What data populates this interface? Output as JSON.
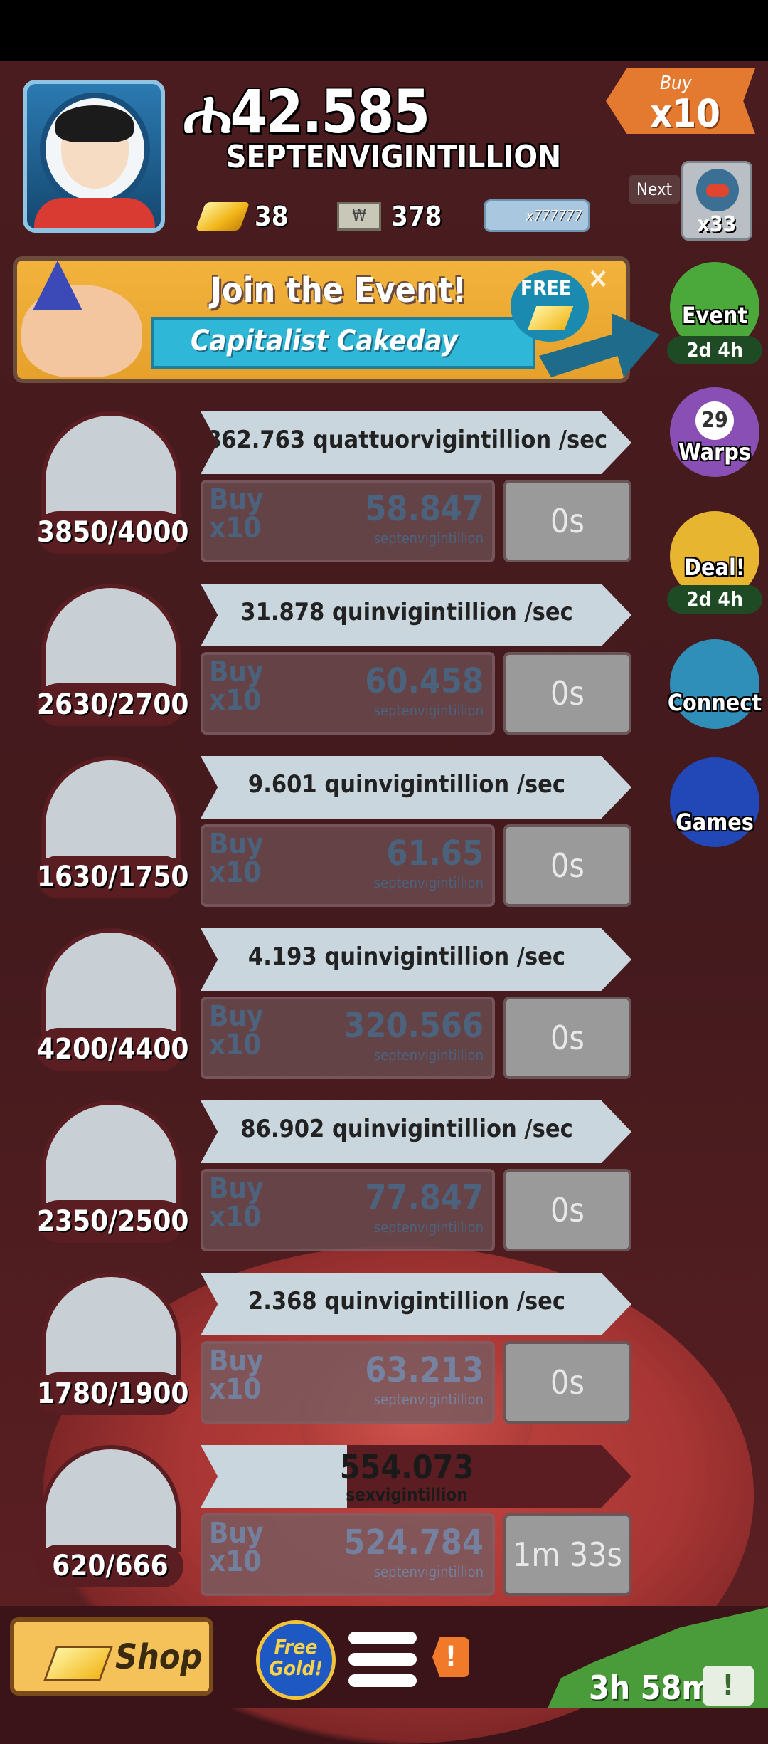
{
  "header": {
    "money_value": "42.585",
    "money_unit": "SEPTENVIGINTILLION",
    "gold_count": "38",
    "megabucks_count": "378",
    "bucks_display": "x777777",
    "buy_multiplier_top": "Buy",
    "buy_multiplier_bottom": "x10",
    "next_label": "Next",
    "next_count": "x33"
  },
  "event_banner": {
    "title": "Join the Event!",
    "subtitle": "Capitalist Cakeday",
    "free_label": "FREE",
    "close_glyph": "×"
  },
  "side_buttons": [
    {
      "label": "Event",
      "timer": "2d 4h"
    },
    {
      "label": "Warps",
      "count": "29"
    },
    {
      "label": "Deal!",
      "timer": "2d 4h"
    },
    {
      "label": "Connect"
    },
    {
      "label": "Games"
    }
  ],
  "investments": [
    {
      "count": "3850/4000",
      "rate": "862.763 quattuorvigintillion /sec",
      "buy_top": "Buy",
      "buy_bottom": "x10",
      "price": "58.847",
      "unit": "septenvigintillion",
      "time": "0s"
    },
    {
      "count": "2630/2700",
      "rate": "31.878 quinvigintillion /sec",
      "buy_top": "Buy",
      "buy_bottom": "x10",
      "price": "60.458",
      "unit": "septenvigintillion",
      "time": "0s"
    },
    {
      "count": "1630/1750",
      "rate": "9.601 quinvigintillion /sec",
      "buy_top": "Buy",
      "buy_bottom": "x10",
      "price": "61.65",
      "unit": "septenvigintillion",
      "time": "0s"
    },
    {
      "count": "4200/4400",
      "rate": "4.193 quinvigintillion /sec",
      "buy_top": "Buy",
      "buy_bottom": "x10",
      "price": "320.566",
      "unit": "septenvigintillion",
      "time": "0s"
    },
    {
      "count": "2350/2500",
      "rate": "86.902 quinvigintillion /sec",
      "buy_top": "Buy",
      "buy_bottom": "x10",
      "price": "77.847",
      "unit": "septenvigintillion",
      "time": "0s"
    },
    {
      "count": "1780/1900",
      "rate": "2.368 quinvigintillion /sec",
      "buy_top": "Buy",
      "buy_bottom": "x10",
      "price": "63.213",
      "unit": "septenvigintillion",
      "time": "0s"
    },
    {
      "count": "620/666",
      "progress_value": "554.073",
      "progress_unit": "sexvigintillion",
      "buy_top": "Buy",
      "buy_bottom": "x10",
      "price": "524.784",
      "unit": "septenvigintillion",
      "time": "1m 33s"
    }
  ],
  "bottom_bar": {
    "shop_label": "Shop",
    "free_gold_label": "Free Gold!",
    "alert_glyph": "!",
    "timer_label": "3h 58m",
    "timer_icon_glyph": "!"
  },
  "colors": {
    "background": "#3a1418",
    "rate_bar": "#c9d6de",
    "buy_button": "#6a4a4e",
    "event_green": "#4a9c3a",
    "tag_orange": "#e37a2f"
  }
}
